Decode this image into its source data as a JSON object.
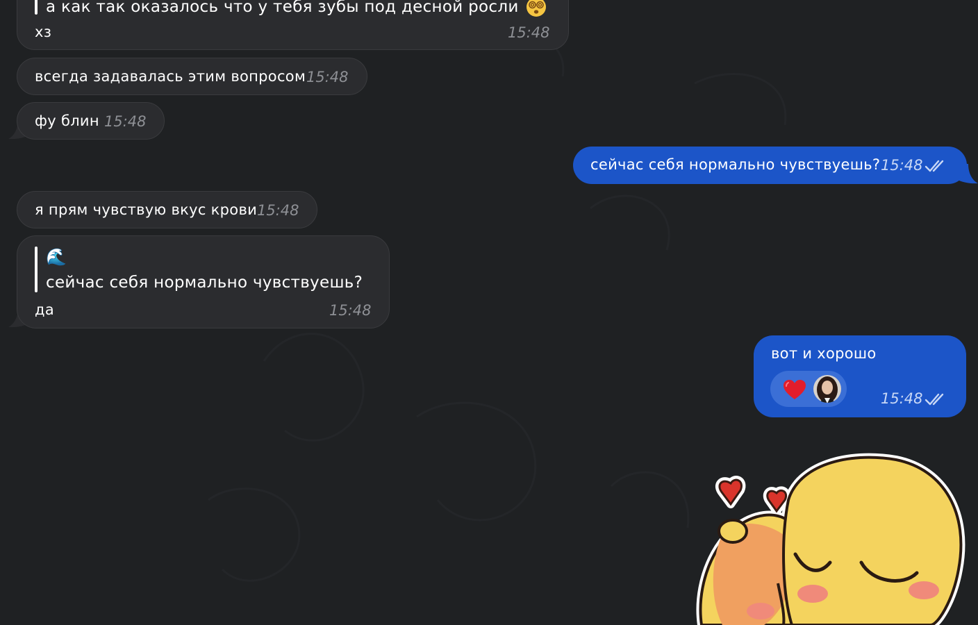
{
  "colors": {
    "background": "#1f2123",
    "incoming_bubble": "#2b2c2f",
    "outgoing_bubble": "#1c55c8",
    "incoming_time": "#8e9095",
    "outgoing_time": "#c9d8f6"
  },
  "messages": {
    "m1": {
      "quote_text": "а как так оказалось что у тебя зубы под десной росли",
      "quote_emoji_icon": "dizzy-face-emoji",
      "text": "хз",
      "time": "15:48"
    },
    "m2": {
      "text": "всегда задавалась этим вопросом",
      "time": "15:48"
    },
    "m3": {
      "text": "фу блин",
      "time": "15:48"
    },
    "m4": {
      "text": "сейчас себя нормально чувствуешь?",
      "time": "15:48",
      "status_icon": "double-check-icon"
    },
    "m5": {
      "text": "я прям чувствую вкус крови",
      "time": "15:48"
    },
    "m6": {
      "quote_author_emoji": "🌊",
      "quote_text": "сейчас себя нормально чувствуешь?",
      "text": "да",
      "time": "15:48"
    },
    "m7": {
      "text": "вот и хорошо",
      "time": "15:48",
      "status_icon": "double-check-icon",
      "reaction": {
        "emoji": "❤️",
        "icon": "heart-icon",
        "user_icon": "user-avatar"
      }
    }
  },
  "sticker": {
    "icon": "hugging-chicks-sticker"
  }
}
